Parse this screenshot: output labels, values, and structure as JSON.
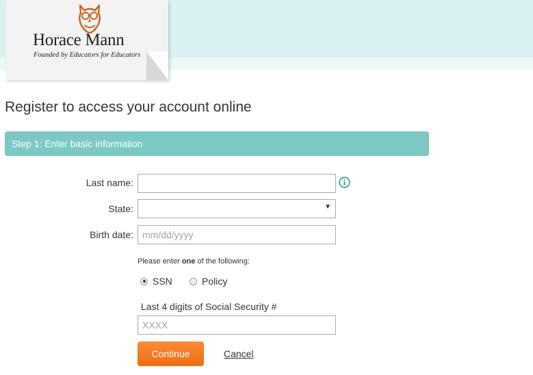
{
  "brand": {
    "name": "Horace Mann",
    "tagline": "Founded by Educators for Educators"
  },
  "page": {
    "title": "Register to access your account online"
  },
  "step": {
    "label": "Step 1: Enter basic information"
  },
  "form": {
    "last_name_label": "Last name:",
    "last_name_value": "",
    "state_label": "State:",
    "state_value": "",
    "birth_date_label": "Birth date:",
    "birth_date_placeholder": "mm/dd/yyyy",
    "instruction_pre": "Please enter ",
    "instruction_bold": "one",
    "instruction_post": " of the following:",
    "options": [
      {
        "label": "SSN",
        "checked": true
      },
      {
        "label": "Policy",
        "checked": false
      }
    ],
    "ssn_label": "Last 4 digits of Social Security #",
    "ssn_placeholder": "XXXX"
  },
  "actions": {
    "continue_label": "Continue",
    "cancel_label": "Cancel"
  },
  "colors": {
    "header_band": "#d9f3f3",
    "step_bar": "#7cc8c4",
    "accent_orange": "#f57c20",
    "info_icon": "#2aa198"
  }
}
